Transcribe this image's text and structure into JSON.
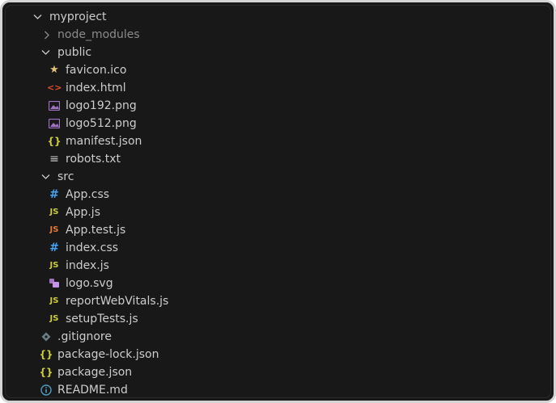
{
  "explorer": {
    "root": {
      "label": "myproject",
      "expanded": true
    },
    "items": [
      {
        "label": "node_modules",
        "kind": "folder",
        "expanded": false,
        "icon": "chevron-right-icon"
      },
      {
        "label": "public",
        "kind": "folder",
        "expanded": true,
        "icon": "chevron-down-icon",
        "children": [
          {
            "label": "favicon.ico",
            "icon": "favicon-star-icon",
            "glyph": "★",
            "color": "#e5c07b"
          },
          {
            "label": "index.html",
            "icon": "html-icon",
            "glyph": "<>",
            "color": "#e44d26"
          },
          {
            "label": "logo192.png",
            "icon": "image-icon",
            "glyph": "",
            "color": "#a074c4"
          },
          {
            "label": "logo512.png",
            "icon": "image-icon",
            "glyph": "",
            "color": "#a074c4"
          },
          {
            "label": "manifest.json",
            "icon": "json-icon",
            "glyph": "{}",
            "color": "#cbcb41"
          },
          {
            "label": "robots.txt",
            "icon": "text-file-icon",
            "glyph": "≡",
            "color": "#c5c5c5"
          }
        ]
      },
      {
        "label": "src",
        "kind": "folder",
        "expanded": true,
        "icon": "chevron-down-icon",
        "children": [
          {
            "label": "App.css",
            "icon": "css-icon",
            "glyph": "#",
            "color": "#42a5f5"
          },
          {
            "label": "App.js",
            "icon": "javascript-icon",
            "glyph": "JS",
            "color": "#cbcb41"
          },
          {
            "label": "App.test.js",
            "icon": "javascript-test-icon",
            "glyph": "JS",
            "color": "#e37933"
          },
          {
            "label": "index.css",
            "icon": "css-icon",
            "glyph": "#",
            "color": "#42a5f5"
          },
          {
            "label": "index.js",
            "icon": "javascript-icon",
            "glyph": "JS",
            "color": "#cbcb41"
          },
          {
            "label": "logo.svg",
            "icon": "svg-icon",
            "glyph": "",
            "color": "#a074c4"
          },
          {
            "label": "reportWebVitals.js",
            "icon": "javascript-icon",
            "glyph": "JS",
            "color": "#cbcb41"
          },
          {
            "label": "setupTests.js",
            "icon": "javascript-icon",
            "glyph": "JS",
            "color": "#cbcb41"
          }
        ]
      },
      {
        "label": ".gitignore",
        "kind": "file",
        "icon": "git-icon",
        "glyph": "◆",
        "color": "#41535b"
      },
      {
        "label": "package-lock.json",
        "kind": "file",
        "icon": "json-icon",
        "glyph": "{}",
        "color": "#cbcb41"
      },
      {
        "label": "package.json",
        "kind": "file",
        "icon": "json-icon",
        "glyph": "{}",
        "color": "#cbcb41"
      },
      {
        "label": "README.md",
        "kind": "file",
        "icon": "info-icon",
        "glyph": "ⓘ",
        "color": "#519aba"
      }
    ]
  },
  "colors": {
    "background": "#181818",
    "text": "#cccccc",
    "frame": "#d4d4d4"
  }
}
